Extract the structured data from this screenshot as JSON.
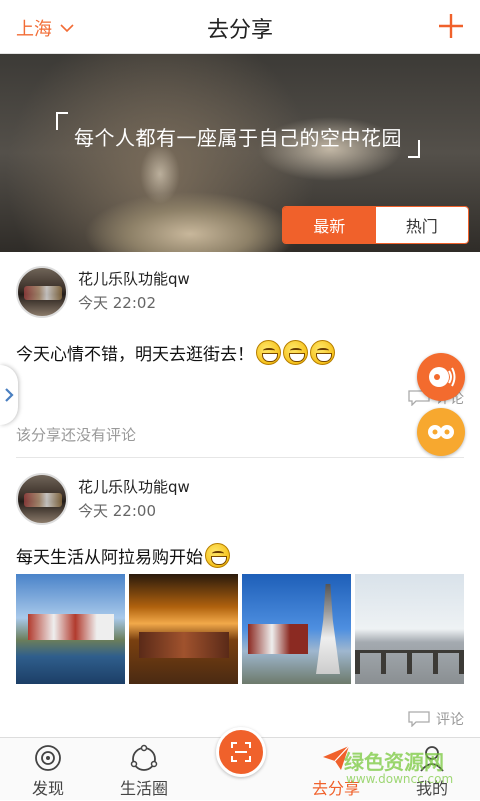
{
  "header": {
    "city": "上海",
    "title": "去分享"
  },
  "banner": {
    "slogan": "每个人都有一座属于自己的空中花园",
    "tabs": [
      "最新",
      "热门"
    ]
  },
  "posts": [
    {
      "user": "花儿乐队功能qw",
      "time": "今天 22:02",
      "text": "今天心情不错，明天去逛街去！",
      "comment_label": "评论",
      "no_comment": "该分享还没有评论"
    },
    {
      "user": "花儿乐队功能qw",
      "time": "今天 22:00",
      "text": "每天生活从阿拉易购开始",
      "comment_label": "评论"
    }
  ],
  "tabbar": [
    "发现",
    "生活圈",
    "去分享",
    "我的"
  ],
  "watermark": {
    "line1": "绿色资源网",
    "line2": "www.downcc.com"
  },
  "colors": {
    "accent": "#f0612b",
    "fab_secondary": "#f7a82f"
  }
}
